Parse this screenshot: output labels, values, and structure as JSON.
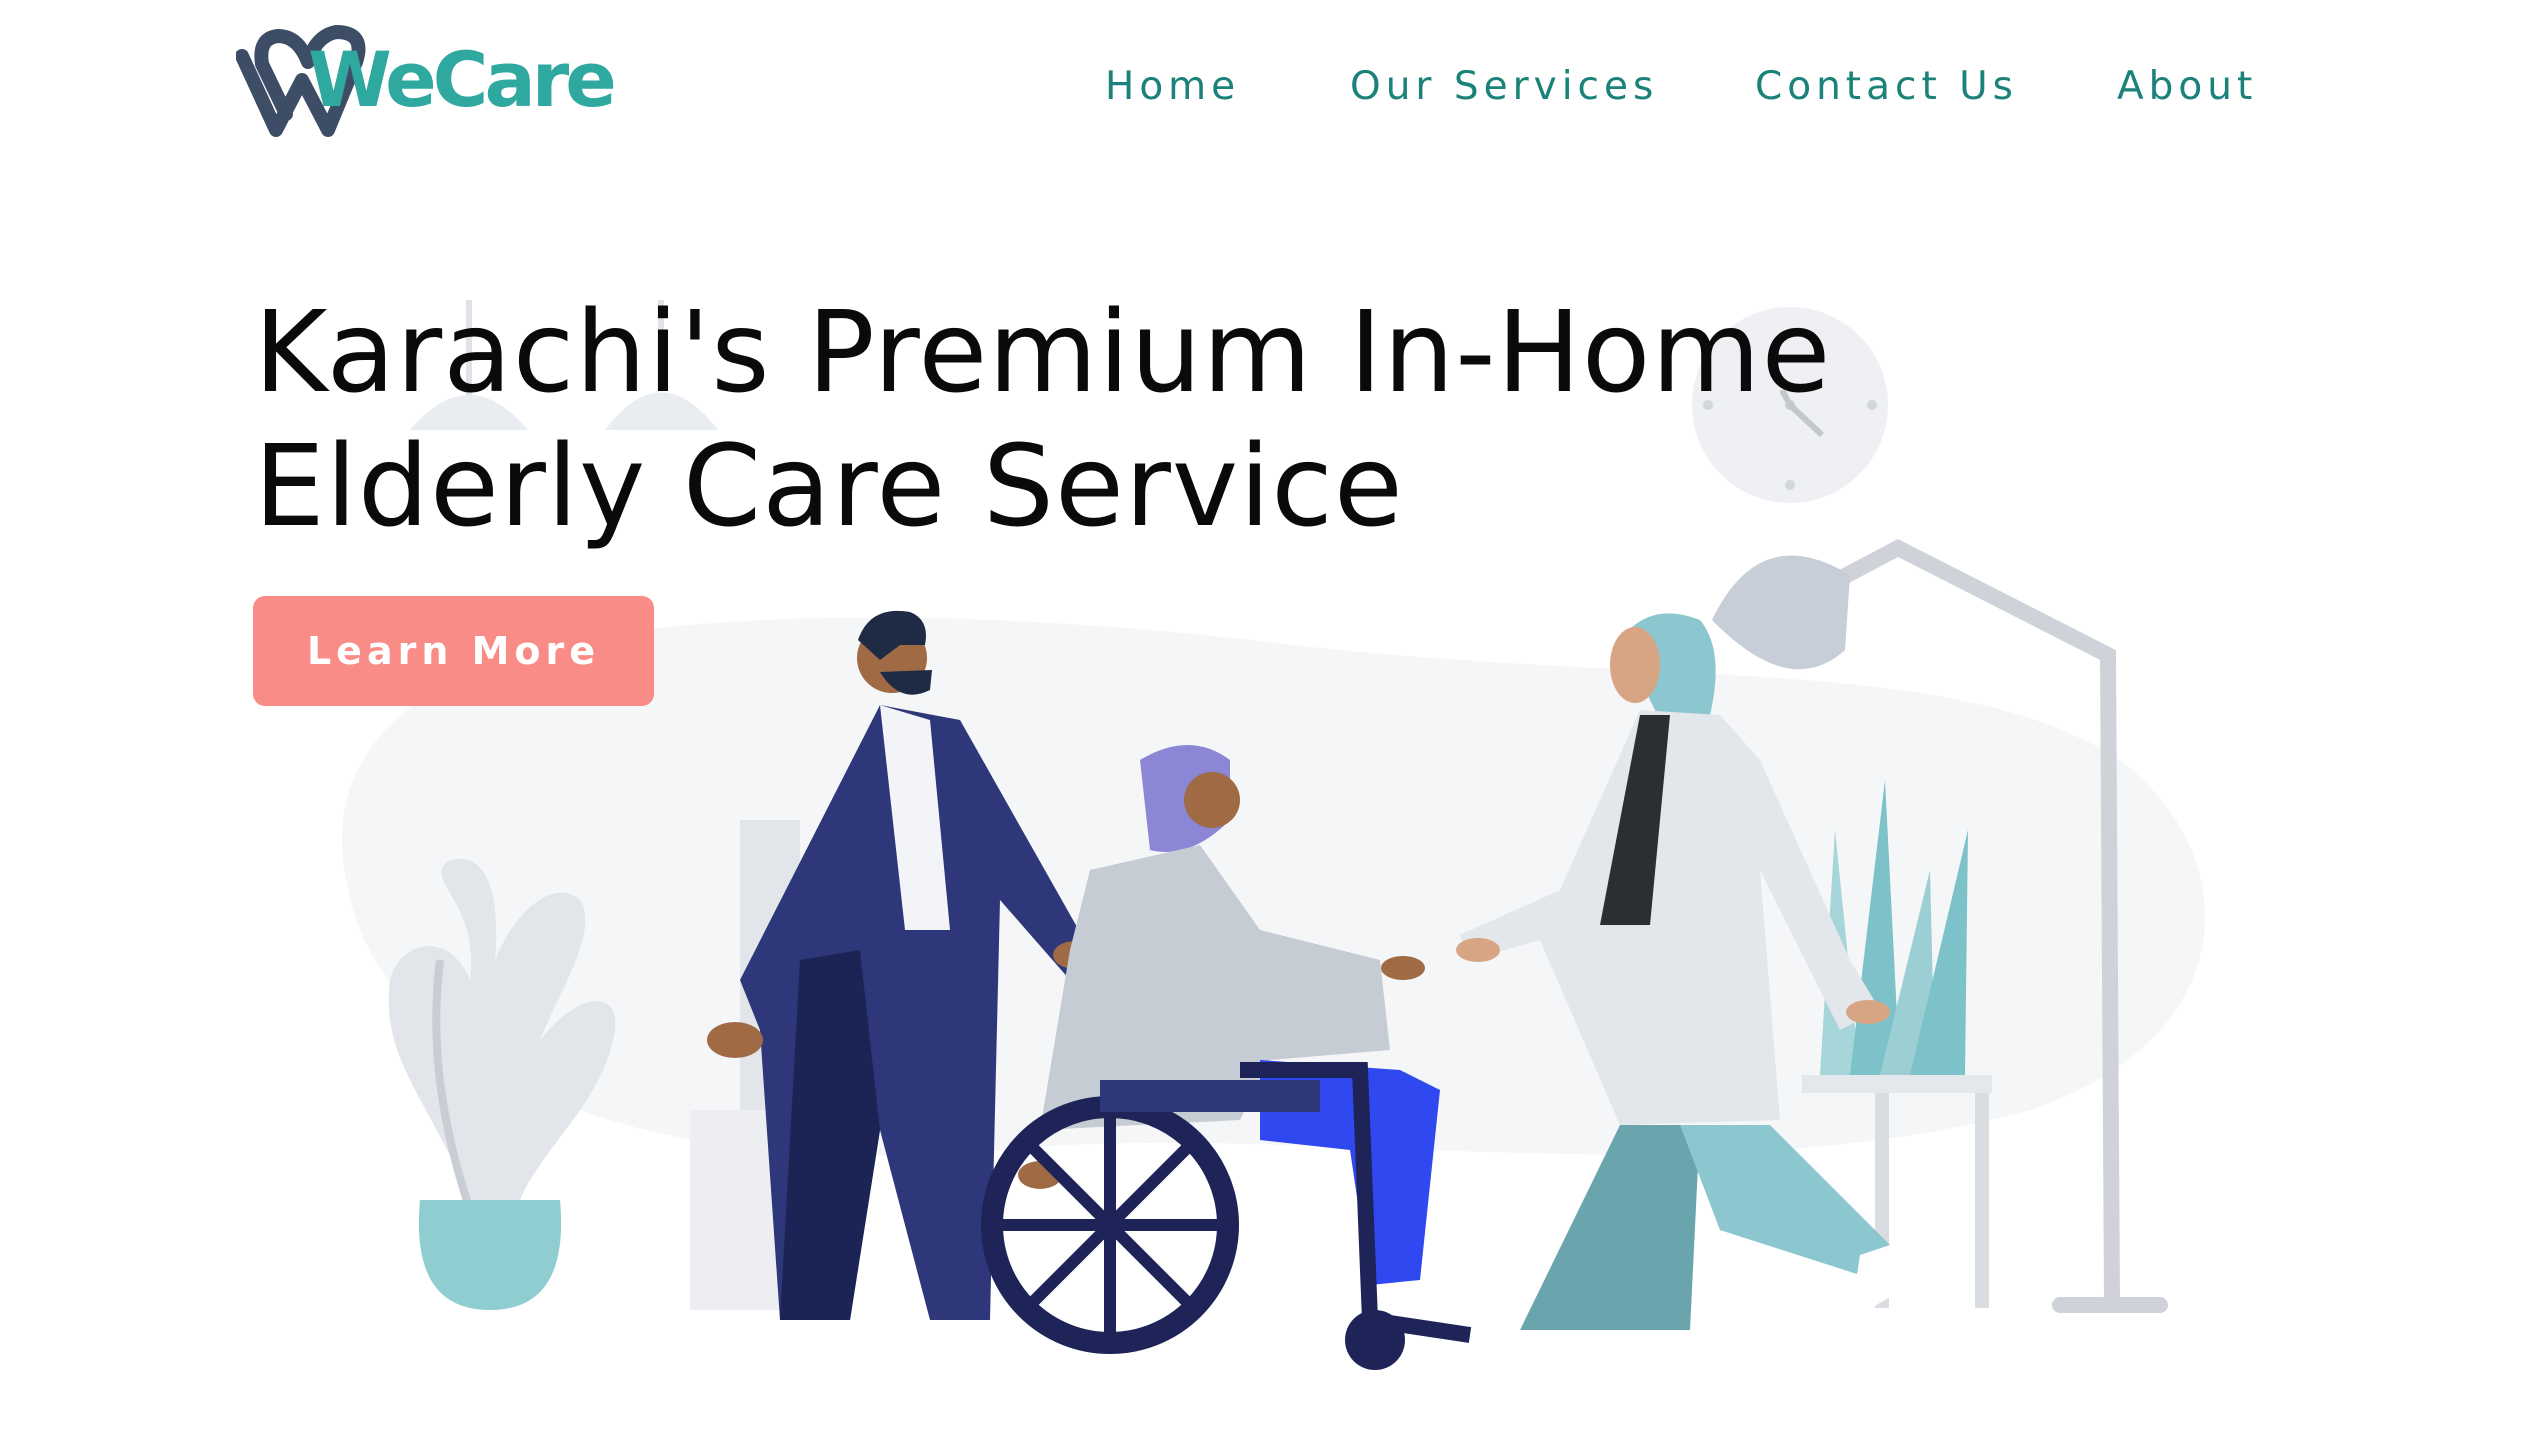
{
  "brand": {
    "name": "WeCare",
    "colors": {
      "teal": "#2fa8a0",
      "navy": "#3d4d66",
      "nav_text": "#1b8279",
      "cta": "#f98c86"
    }
  },
  "nav": {
    "items": [
      {
        "label": "Home"
      },
      {
        "label": "Our Services"
      },
      {
        "label": "Contact Us"
      },
      {
        "label": "About"
      }
    ]
  },
  "hero": {
    "title_line1": "Karachi's Premium In-Home",
    "title_line2": "Elderly Care Service",
    "cta_label": "Learn More"
  },
  "illustration": {
    "icons": [
      "wall-clock-icon",
      "floor-lamp-icon",
      "pendant-lamp-icon",
      "plant-icon",
      "wheelchair-icon"
    ]
  }
}
